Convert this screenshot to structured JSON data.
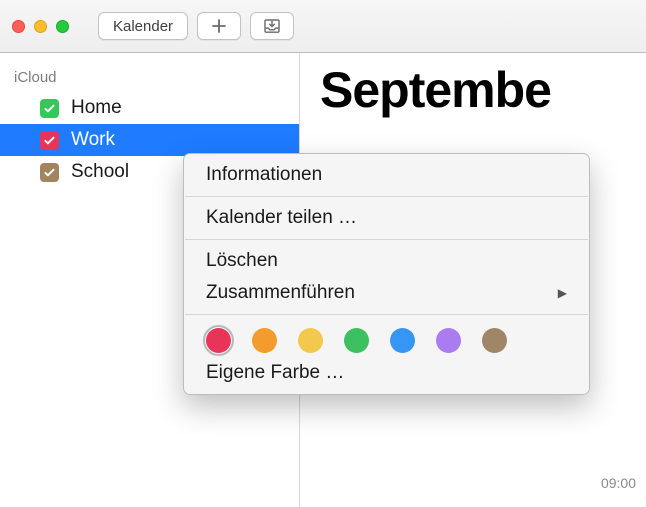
{
  "titlebar": {
    "calendars_button": "Kalender"
  },
  "sidebar": {
    "group_header": "iCloud",
    "items": [
      {
        "label": "Home",
        "color": "#34c759",
        "selected": false
      },
      {
        "label": "Work",
        "color": "#e73458",
        "selected": true
      },
      {
        "label": "School",
        "color": "#a2845e",
        "selected": false
      }
    ]
  },
  "main": {
    "month_title": "Septembe",
    "time_label_1": "09:00"
  },
  "context_menu": {
    "info": "Informationen",
    "share": "Kalender teilen …",
    "delete": "Löschen",
    "merge": "Zusammenführen",
    "custom_color": "Eigene Farbe …",
    "colors": [
      {
        "hex": "#e73458",
        "selected": true
      },
      {
        "hex": "#f39c2d",
        "selected": false
      },
      {
        "hex": "#f2c94c",
        "selected": false
      },
      {
        "hex": "#3cc060",
        "selected": false
      },
      {
        "hex": "#3596f6",
        "selected": false
      },
      {
        "hex": "#a97cf0",
        "selected": false
      },
      {
        "hex": "#9f8668",
        "selected": false
      }
    ]
  }
}
